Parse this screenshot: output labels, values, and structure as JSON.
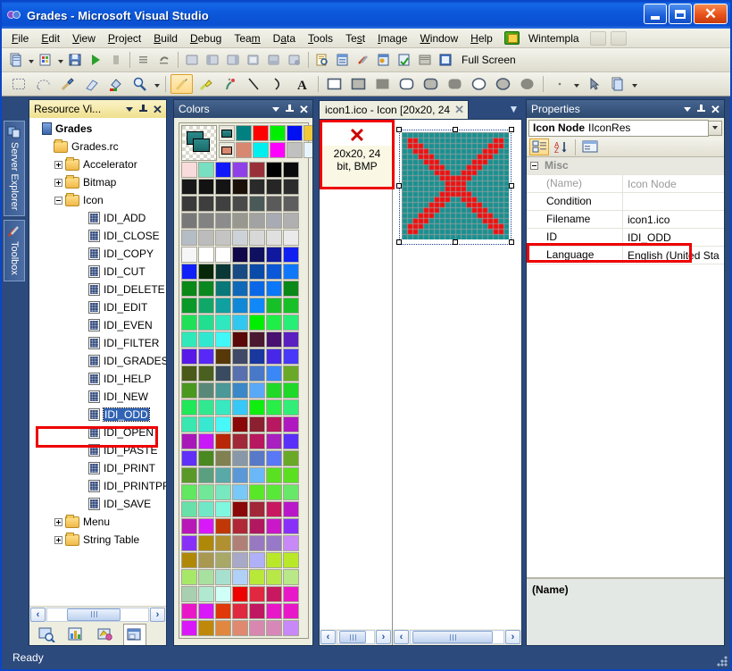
{
  "window": {
    "title": "Grades - Microsoft Visual Studio",
    "app_icon": "visual-studio-icon",
    "minimize_label": "Minimize",
    "maximize_label": "Maximize",
    "close_label": "✕"
  },
  "menubar": {
    "items": [
      {
        "label": "File",
        "accel": "F"
      },
      {
        "label": "Edit",
        "accel": "E"
      },
      {
        "label": "View",
        "accel": "V"
      },
      {
        "label": "Project",
        "accel": "P"
      },
      {
        "label": "Build",
        "accel": "B"
      },
      {
        "label": "Debug",
        "accel": "D"
      },
      {
        "label": "Team",
        "accel": "m"
      },
      {
        "label": "Data",
        "accel": "a"
      },
      {
        "label": "Tools",
        "accel": "T"
      },
      {
        "label": "Test",
        "accel": "s"
      },
      {
        "label": "Image",
        "accel": "I"
      },
      {
        "label": "Window",
        "accel": "W"
      },
      {
        "label": "Help",
        "accel": "H"
      }
    ],
    "addin_label": "Wintempla"
  },
  "toolbar_standard": {
    "fullscreen_label": "Full Screen",
    "buttons": [
      "new-project-icon",
      "add-new-item-icon",
      "save-all-icon",
      "start-debug-icon",
      "pause-icon",
      "step-icon",
      "undo-icon",
      "redo-icon",
      "window1-icon",
      "window2-icon",
      "window3-icon",
      "window4-icon",
      "window5-icon",
      "find-icon",
      "solution-explorer-icon",
      "properties-window-icon",
      "toolbox-icon",
      "object-browser-icon",
      "error-list-icon",
      "output-icon",
      "command-window-icon",
      "full-screen-icon"
    ]
  },
  "toolbar_image": {
    "buttons": [
      {
        "name": "rect-select-tool",
        "selected": false
      },
      {
        "name": "lasso-select-tool",
        "selected": false
      },
      {
        "name": "eyedropper-tool",
        "selected": false
      },
      {
        "name": "eraser-tool",
        "selected": false
      },
      {
        "name": "fill-tool",
        "selected": false
      },
      {
        "name": "magnifier-tool",
        "selected": false
      },
      {
        "name": "pencil-tool",
        "selected": true
      },
      {
        "name": "brush-tool",
        "selected": false
      },
      {
        "name": "airbrush-tool",
        "selected": false
      },
      {
        "name": "line-tool",
        "selected": false
      },
      {
        "name": "curve-tool",
        "selected": false
      },
      {
        "name": "text-tool",
        "selected": false
      },
      {
        "name": "rectangle-outline-tool",
        "selected": false
      },
      {
        "name": "rectangle-filled-tool",
        "selected": false
      },
      {
        "name": "rectangle-solid-tool",
        "selected": false
      },
      {
        "name": "rounded-rect-outline-tool",
        "selected": false
      },
      {
        "name": "rounded-rect-filled-tool",
        "selected": false
      },
      {
        "name": "rounded-rect-solid-tool",
        "selected": false
      },
      {
        "name": "ellipse-outline-tool",
        "selected": false
      },
      {
        "name": "ellipse-filled-tool",
        "selected": false
      },
      {
        "name": "ellipse-solid-tool",
        "selected": false
      }
    ]
  },
  "docked_tabs": {
    "items": [
      {
        "label": "Server Explorer",
        "icon": "server-explorer-icon"
      },
      {
        "label": "Toolbox",
        "icon": "toolbox-icon"
      }
    ]
  },
  "resource_view": {
    "title": "Resource Vi...",
    "tree": [
      {
        "label": "Grades",
        "depth": 0,
        "icon": "project-icon",
        "expander": "none",
        "bold": true
      },
      {
        "label": "Grades.rc",
        "depth": 1,
        "icon": "folder",
        "expander": "none"
      },
      {
        "label": "Accelerator",
        "depth": 2,
        "icon": "folder",
        "expander": "plus"
      },
      {
        "label": "Bitmap",
        "depth": 2,
        "icon": "folder",
        "expander": "plus"
      },
      {
        "label": "Icon",
        "depth": 2,
        "icon": "folder",
        "expander": "minus"
      },
      {
        "label": "IDI_ADD",
        "depth": 4,
        "icon": "resource"
      },
      {
        "label": "IDI_CLOSE",
        "depth": 4,
        "icon": "resource"
      },
      {
        "label": "IDI_COPY",
        "depth": 4,
        "icon": "resource"
      },
      {
        "label": "IDI_CUT",
        "depth": 4,
        "icon": "resource"
      },
      {
        "label": "IDI_DELETE",
        "depth": 4,
        "icon": "resource"
      },
      {
        "label": "IDI_EDIT",
        "depth": 4,
        "icon": "resource"
      },
      {
        "label": "IDI_EVEN",
        "depth": 4,
        "icon": "resource"
      },
      {
        "label": "IDI_FILTER",
        "depth": 4,
        "icon": "resource"
      },
      {
        "label": "IDI_GRADES",
        "depth": 4,
        "icon": "resource"
      },
      {
        "label": "IDI_HELP",
        "depth": 4,
        "icon": "resource"
      },
      {
        "label": "IDI_NEW",
        "depth": 4,
        "icon": "resource"
      },
      {
        "label": "IDI_ODD",
        "depth": 4,
        "icon": "resource",
        "selected": true
      },
      {
        "label": "IDI_OPEN",
        "depth": 4,
        "icon": "resource"
      },
      {
        "label": "IDI_PASTE",
        "depth": 4,
        "icon": "resource"
      },
      {
        "label": "IDI_PRINT",
        "depth": 4,
        "icon": "resource"
      },
      {
        "label": "IDI_PRINTPR",
        "depth": 4,
        "icon": "resource"
      },
      {
        "label": "IDI_SAVE",
        "depth": 4,
        "icon": "resource"
      },
      {
        "label": "Menu",
        "depth": 2,
        "icon": "folder",
        "expander": "plus"
      },
      {
        "label": "String Table",
        "depth": 2,
        "icon": "folder",
        "expander": "plus"
      }
    ],
    "bottom_tabs": [
      {
        "name": "solution-explorer-tab",
        "active": false
      },
      {
        "name": "class-view-tab",
        "active": false
      },
      {
        "name": "property-manager-tab",
        "active": false
      },
      {
        "name": "resource-view-tab",
        "active": true
      }
    ],
    "scroll_left": "‹",
    "scroll_right": "›"
  },
  "colors_panel": {
    "title": "Colors",
    "selected_swatch": "screen-transparent",
    "grid": [
      [
        "#008080",
        "#ff0000",
        "#00ee00",
        "#0010f0",
        "#f0c838"
      ],
      [
        "#d88870",
        "#00eeee",
        "#ff00ff",
        "#c0c0c0",
        "#e8f4fc"
      ],
      [
        "#fadbdb",
        "#78dfc0",
        "#1018f8",
        "#9040e8",
        "#98303a",
        "#000000",
        "#0a0a0a"
      ],
      [
        "#181818",
        "#121212",
        "#141414",
        "#1b1008",
        "#2a2a2a",
        "#262626",
        "#2c2c2c"
      ],
      [
        "#3a3a3a",
        "#3e3e3e",
        "#404040",
        "#4a4a4a",
        "#4a5a58",
        "#5a5a5a",
        "#5e5e5e"
      ],
      [
        "#787878",
        "#828282",
        "#8c8c8c",
        "#989890",
        "#a2a2a2",
        "#a8aab4",
        "#b0b0b0"
      ],
      [
        "#b4bcc4",
        "#bcbcbc",
        "#c4c4c4",
        "#ccd2d8",
        "#d8d8d8",
        "#e0e0e0",
        "#eaeaea"
      ],
      [
        "#f6f6f6",
        "#ffffff",
        "#fefefe",
        "#100848",
        "#101060",
        "#1018a0",
        "#1020f0"
      ],
      [
        "#1020f8",
        "#062808",
        "#0a3836",
        "#184a84",
        "#0a4aa8",
        "#0a58d8",
        "#1078f8"
      ],
      [
        "#0a8818",
        "#0a8820",
        "#0a7878",
        "#1068b8",
        "#0a68e8",
        "#0a78f8",
        "#0a8818"
      ],
      [
        "#0a9828",
        "#10a868",
        "#10a0a0",
        "#1088d8",
        "#1088f8",
        "#18c028",
        "#18c028"
      ],
      [
        "#20e058",
        "#20e090",
        "#30e8c0",
        "#30c8f0",
        "#00ee00",
        "#20ee48",
        "#28ee78"
      ],
      [
        "#30e8b8",
        "#30e8d0",
        "#40f8f8",
        "#5a0808",
        "#4a1830",
        "#481070",
        "#5a20c0"
      ],
      [
        "#5818e8",
        "#5828f8",
        "#583808",
        "#404a68",
        "#1838a0",
        "#4828e8",
        "#4838f8"
      ],
      [
        "#4a5a18",
        "#4a6020",
        "#3a4a60",
        "#5870b0",
        "#4878c8",
        "#3a88f8",
        "#6aa828"
      ],
      [
        "#4a9820",
        "#5a8878",
        "#4a9898",
        "#3a88c8",
        "#5aa8f8",
        "#20d828",
        "#20d828"
      ],
      [
        "#20e858",
        "#30e890",
        "#38e8c0",
        "#38c8f8",
        "#10ee10",
        "#28ee48",
        "#30ee78"
      ],
      [
        "#38e8b0",
        "#38e8d0",
        "#48f8f8",
        "#8a0808",
        "#8a2030",
        "#b81860",
        "#b018c0"
      ],
      [
        "#a818b8",
        "#c818f8",
        "#b82808",
        "#a02838",
        "#b81860",
        "#a820c0",
        "#5830f8"
      ],
      [
        "#6030f8",
        "#4a8820",
        "#808050",
        "#8898a8",
        "#5878c8",
        "#5878f8",
        "#6aa828"
      ],
      [
        "#5a9828",
        "#5aa080",
        "#5aa8a8",
        "#5a98d8",
        "#6ab8f8",
        "#5ae020",
        "#5ae020"
      ],
      [
        "#60e860",
        "#70e898",
        "#78e8c0",
        "#78c8f8",
        "#58e828",
        "#58e838",
        "#68e868"
      ],
      [
        "#68e0a8",
        "#70e8c8",
        "#80f8e0",
        "#8a0808",
        "#a02838",
        "#c81860",
        "#b818c8"
      ],
      [
        "#b818b8",
        "#d818f8",
        "#c03808",
        "#b02838",
        "#b01860",
        "#c818c8",
        "#8830f8"
      ],
      [
        "#8830f8",
        "#b08808",
        "#b09030",
        "#b08078",
        "#9878c0",
        "#9878c8",
        "#c888f8"
      ],
      [
        "#b08808",
        "#a89850",
        "#a8a868",
        "#a8a8c8",
        "#b0b0f8",
        "#b8e828",
        "#b8e828"
      ],
      [
        "#a8e868",
        "#a8e0a0",
        "#a8e0d0",
        "#b0d0f8",
        "#b8e838",
        "#b8e848",
        "#b8e888"
      ],
      [
        "#a8d0b0",
        "#b0e8d0",
        "#d0fff8",
        "#ee0000",
        "#e02840",
        "#c81860",
        "#e818c8"
      ],
      [
        "#e818c8",
        "#d818f8",
        "#e03808",
        "#e02840",
        "#c01860",
        "#e818c8",
        "#e818c8"
      ],
      [
        "#d818f8",
        "#c08808",
        "#e08840",
        "#e08870",
        "#d888b0",
        "#d888b8",
        "#c888f8"
      ]
    ]
  },
  "document": {
    "tab_label": "icon1.ico - Icon [20x20, 24",
    "close_label": "✕",
    "callout": {
      "x_mark": "✕",
      "line1": "20x20, 24",
      "line2": "bit, BMP"
    },
    "icon_preview": {
      "background_color": "#199090",
      "foreground_color": "#ee1111",
      "size": "20x20",
      "shape": "red-x"
    },
    "scroll_left": "‹",
    "scroll_right": "›"
  },
  "properties": {
    "title": "Properties",
    "object_type": "Icon Node",
    "object_name": "IIconRes",
    "toolbar": [
      {
        "name": "categorized-button",
        "active": true
      },
      {
        "name": "alphabetical-button",
        "active": false
      },
      {
        "name": "property-pages-button",
        "active": false
      }
    ],
    "category": "Misc",
    "rows": [
      {
        "name": "(Name)",
        "value": "Icon Node",
        "dim": true
      },
      {
        "name": "Condition",
        "value": ""
      },
      {
        "name": "Filename",
        "value": "icon1.ico"
      },
      {
        "name": "ID",
        "value": "IDI_ODD",
        "highlighted": true
      },
      {
        "name": "Language",
        "value": "English (United Sta"
      }
    ],
    "description_title": "(Name)"
  },
  "statusbar": {
    "text": "Ready"
  },
  "annotations": {
    "highlight_color": "#ee0000",
    "boxes": [
      "callout-size-box",
      "tree-selected-node-box",
      "properties-id-row-box"
    ]
  }
}
